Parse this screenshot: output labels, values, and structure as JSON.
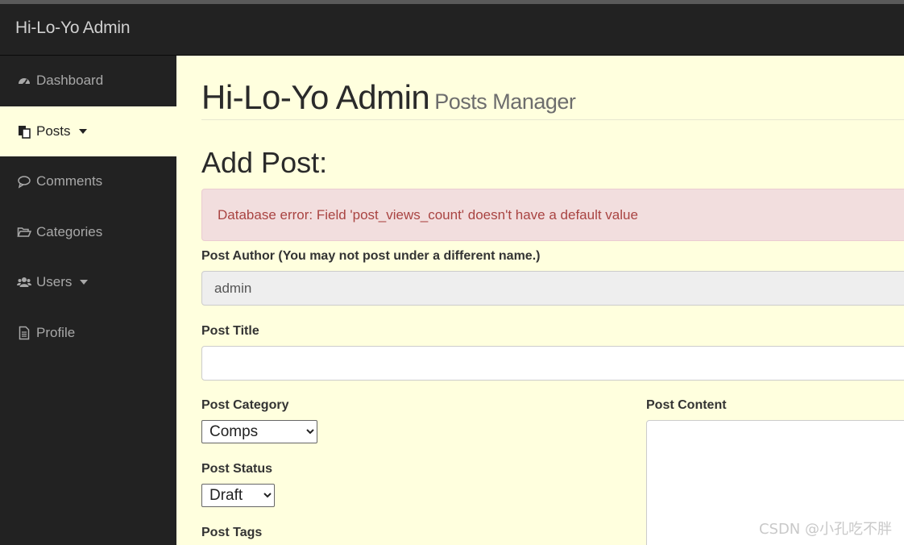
{
  "navbar": {
    "brand": "Hi-Lo-Yo Admin"
  },
  "sidebar": {
    "items": [
      {
        "label": "Dashboard",
        "icon": "dashboard-icon"
      },
      {
        "label": "Posts",
        "icon": "posts-icon",
        "active": true,
        "dropdown": true
      },
      {
        "label": "Comments",
        "icon": "comment-icon"
      },
      {
        "label": "Categories",
        "icon": "folder-open-icon"
      },
      {
        "label": "Users",
        "icon": "users-icon",
        "dropdown": true
      },
      {
        "label": "Profile",
        "icon": "file-text-icon"
      }
    ]
  },
  "page": {
    "title": "Hi-Lo-Yo Admin",
    "subtitle": "Posts Manager",
    "section_title": "Add Post:"
  },
  "alert": {
    "message": "Database error: Field 'post_views_count' doesn't have a default value"
  },
  "form": {
    "author_label": "Post Author (You may not post under a different name.)",
    "author_value": "admin",
    "title_label": "Post Title",
    "title_value": "",
    "category_label": "Post Category",
    "category_value": "Comps",
    "status_label": "Post Status",
    "status_value": "Draft",
    "tags_label": "Post Tags",
    "content_label": "Post Content"
  },
  "watermark": "CSDN @小孔吃不胖",
  "colors": {
    "navbar_bg": "#222222",
    "page_bg": "#ffffde",
    "alert_bg": "#f2dede",
    "alert_text": "#a94442"
  }
}
